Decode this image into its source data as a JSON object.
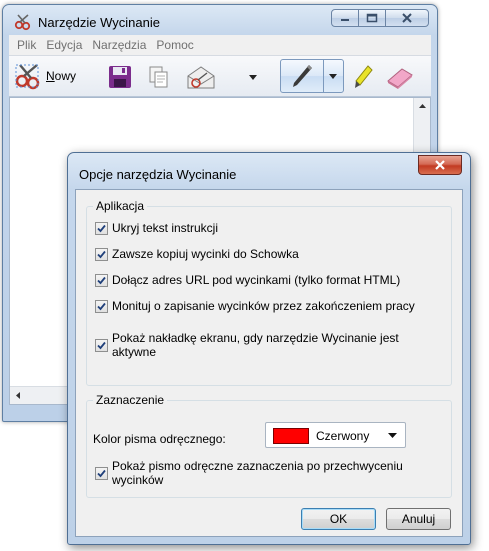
{
  "main_window": {
    "title": "Narzędzie Wycinanie",
    "menu": [
      "Plik",
      "Edycja",
      "Narzędzia",
      "Pomoc"
    ],
    "toolbar": {
      "new_label_underlined": "N",
      "new_label_rest": "owy"
    }
  },
  "dialog": {
    "title": "Opcje narzędzia Wycinanie",
    "groups": {
      "application": {
        "legend": "Aplikacja",
        "options": [
          {
            "label": "Ukryj tekst instrukcji",
            "checked": true
          },
          {
            "label": "Zawsze kopiuj wycinki do Schowka",
            "checked": true
          },
          {
            "label": "Dołącz adres URL pod wycinkami (tylko format HTML)",
            "checked": true
          },
          {
            "label": "Monituj o zapisanie wycinków przez zakończeniem pracy",
            "checked": true
          },
          {
            "label": "Pokaż nakładkę ekranu, gdy narzędzie Wycinanie jest aktywne",
            "checked": true
          }
        ]
      },
      "selection": {
        "legend": "Zaznaczenie",
        "ink_color_label": "Kolor pisma odręcznego:",
        "ink_color_value": "Czerwony",
        "ink_color_hex": "#ff0000",
        "show_ink_label": "Pokaż pismo odręczne zaznaczenia po przechwyceniu wycinków",
        "show_ink_checked": true
      }
    },
    "buttons": {
      "ok": "OK",
      "cancel": "Anuluj"
    }
  }
}
